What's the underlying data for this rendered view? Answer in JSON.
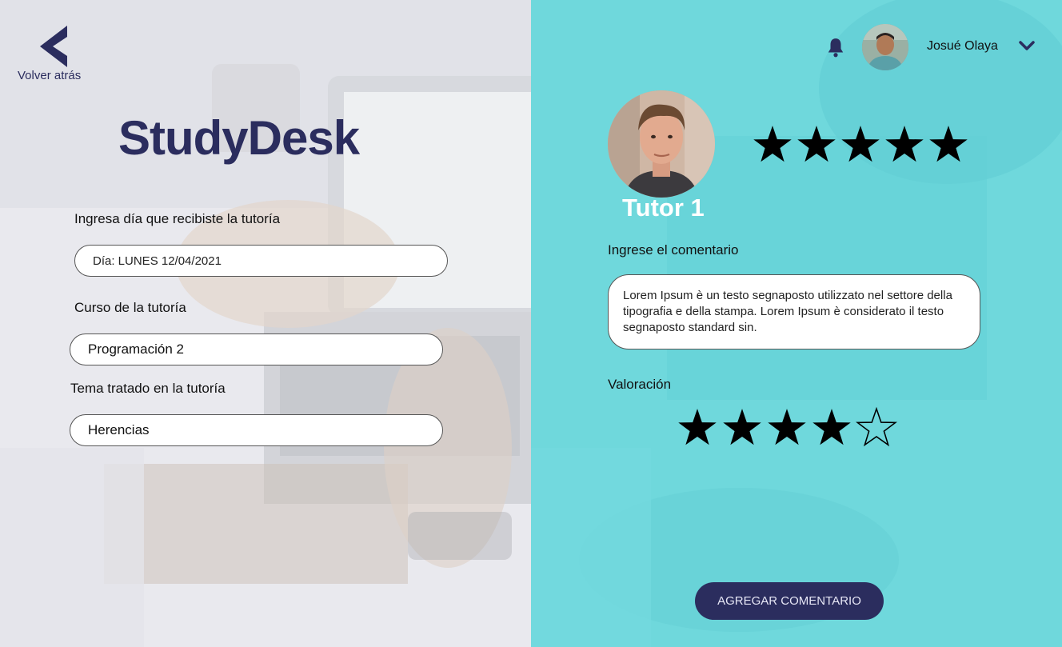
{
  "app": {
    "logo": "StudyDesk"
  },
  "nav": {
    "back_label": "Volver atrás"
  },
  "form": {
    "date_label": "Ingresa día que recibiste la tutoría",
    "date_value": "Día: LUNES 12/04/2021",
    "course_label": "Curso de la tutoría",
    "course_value": "Programación 2",
    "topic_label": "Tema tratado en la tutoría",
    "topic_value": "Herencias"
  },
  "user": {
    "name": "Josué Olaya"
  },
  "tutor": {
    "name": "Tutor 1",
    "rating": 5,
    "rating_max": 5
  },
  "review": {
    "comment_label": "Ingrese el comentario",
    "comment_text": "Lorem Ipsum è un testo segnaposto utilizzato nel settore della tipografia e della stampa. Lorem Ipsum è considerato il testo segnaposto standard sin.",
    "rating_label": "Valoración",
    "rating": 4,
    "rating_max": 5,
    "submit_label": "AGREGAR COMENTARIO"
  },
  "colors": {
    "accent": "#2b2d5e",
    "right_panel": "#6fd8dc",
    "left_panel": "#e7e7ec"
  },
  "icons": {
    "back": "chevron-left-icon",
    "bell": "bell-icon",
    "dropdown": "chevron-down-icon",
    "star": "star-icon"
  }
}
